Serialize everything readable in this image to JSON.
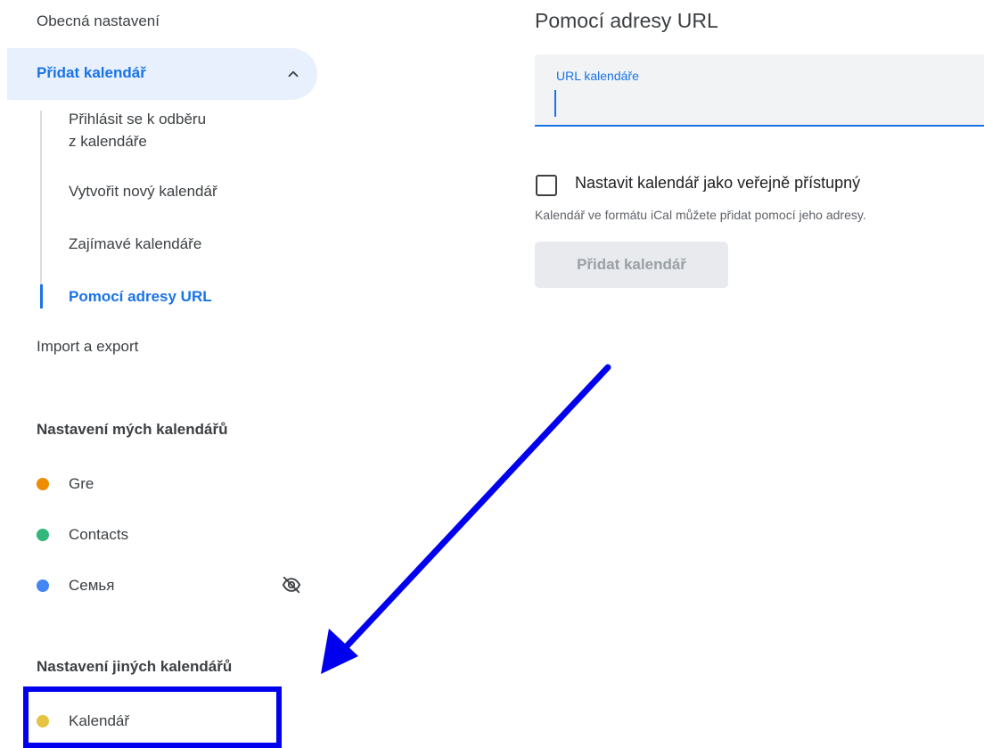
{
  "sidebar": {
    "general_settings": "Obecná nastavení",
    "add_calendar": {
      "label": "Přidat kalendář",
      "expanded_icon": "chevron-up-icon",
      "children": [
        {
          "label_line1": "Přihlásit se k odběru",
          "label_line2": "z kalendáře"
        },
        {
          "label": "Vytvořit nový kalendář"
        },
        {
          "label": "Zajímavé kalendáře"
        },
        {
          "label": "Pomocí adresy URL",
          "active": true
        }
      ]
    },
    "import_export": "Import a export",
    "my_calendars": {
      "heading": "Nastavení mých kalendářů",
      "items": [
        {
          "label": "Gre",
          "color": "#ef8c00"
        },
        {
          "label": "Contacts",
          "color": "#33b679"
        },
        {
          "label": "Семья",
          "color": "#4285f4",
          "hidden_icon": "eye-off-icon"
        }
      ]
    },
    "other_calendars": {
      "heading": "Nastavení jiných kalendářů",
      "items": [
        {
          "label": "Kalendář",
          "color": "#e4c441"
        }
      ]
    }
  },
  "main": {
    "title": "Pomocí adresy URL",
    "url_field": {
      "label": "URL kalendáře",
      "value": ""
    },
    "public_checkbox": {
      "label": "Nastavit kalendář jako veřejně přístupný",
      "checked": false
    },
    "helper_text": "Kalendář ve formátu iCal můžete přidat pomocí jeho adresy.",
    "add_button_label": "Přidat kalendář"
  },
  "colors": {
    "accent": "#1a73e8",
    "selected_bg": "#e8f0fe",
    "annotation": "#0000ee"
  }
}
